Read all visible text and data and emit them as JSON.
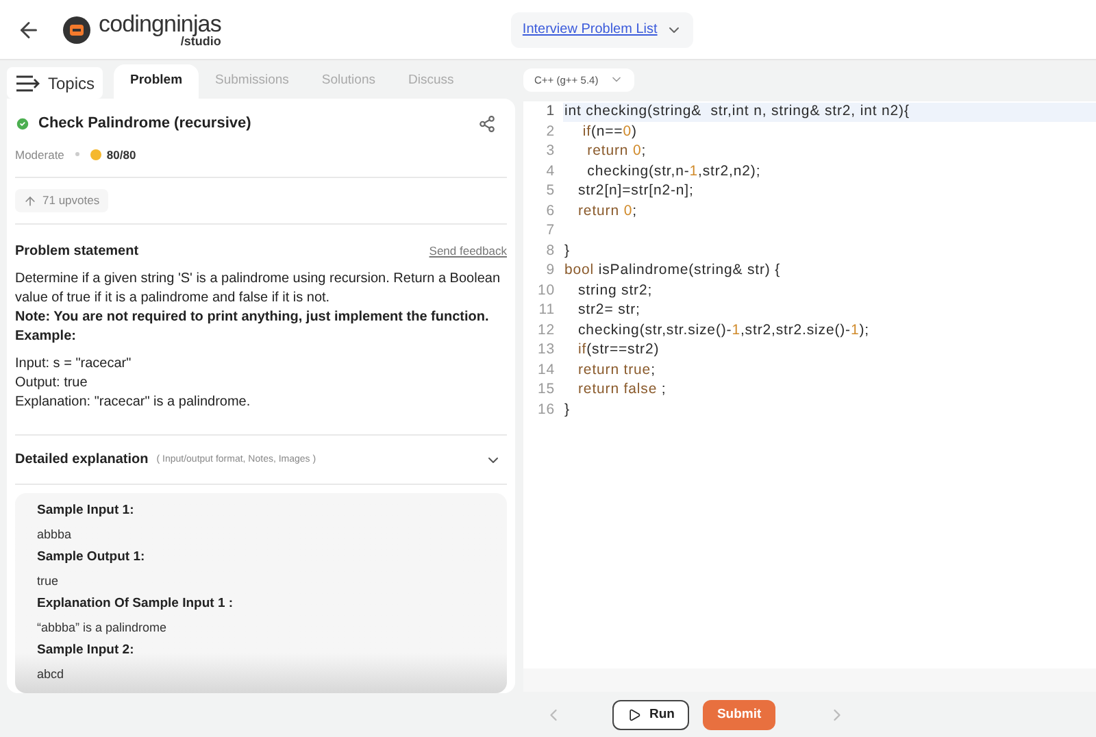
{
  "header": {
    "logo_name": "codingninjas",
    "logo_sub": "/studio",
    "problem_list": "Interview Problem List"
  },
  "tabs": [
    {
      "label": "Topics",
      "kind": "menu",
      "selected": false
    },
    {
      "label": "Problem",
      "kind": "tab",
      "selected": true
    },
    {
      "label": "Submissions",
      "kind": "tab",
      "selected": false
    },
    {
      "label": "Solutions",
      "kind": "tab",
      "selected": false
    },
    {
      "label": "Discuss",
      "kind": "tab",
      "selected": false
    }
  ],
  "problem": {
    "title": "Check Palindrome (recursive)",
    "solved": true,
    "difficulty": "Moderate",
    "score": "80/80",
    "upvotes": "71 upvotes",
    "statement_heading": "Problem statement",
    "feedback": "Send feedback",
    "statement": [
      "Determine if a given string 'S' is a palindrome using recursion. Return a Boolean value of true if it is a palindrome and false if it is not."
    ],
    "note": "Note: You are not required to print anything, just implement the function.",
    "example_heading": "Example:",
    "example": [
      "Input: s = \"racecar\"",
      "Output: true",
      "Explanation: \"racecar\" is a palindrome."
    ],
    "details_heading": "Detailed explanation",
    "details_hint": "( Input/output format, Notes, Images )",
    "samples": [
      {
        "kind": "heading",
        "text": "Sample Input 1:"
      },
      {
        "kind": "value",
        "text": "abbba"
      },
      {
        "kind": "heading",
        "text": "Sample Output 1:"
      },
      {
        "kind": "value",
        "text": "true"
      },
      {
        "kind": "heading",
        "text": "Explanation Of Sample Input 1 :"
      },
      {
        "kind": "value",
        "text": "“abbba” is a palindrome"
      },
      {
        "kind": "heading",
        "text": "Sample Input 2:"
      },
      {
        "kind": "value",
        "text": "abcd"
      }
    ]
  },
  "editor": {
    "language": "C++ (g++ 5.4)",
    "lines": [
      {
        "number": "1",
        "selected": true,
        "tokens": [
          {
            "kind": "plain",
            "text": "int checking(string&  str,int n, string& str2, int n2){"
          }
        ]
      },
      {
        "number": "2",
        "selected": false,
        "tokens": [
          {
            "kind": "keyword",
            "text": "    if"
          },
          {
            "kind": "plain",
            "text": "(n=="
          },
          {
            "kind": "number",
            "text": "0"
          },
          {
            "kind": "plain",
            "text": ")"
          }
        ]
      },
      {
        "number": "3",
        "selected": false,
        "tokens": [
          {
            "kind": "keyword",
            "text": "     return "
          },
          {
            "kind": "number",
            "text": "0"
          },
          {
            "kind": "plain",
            "text": ";"
          }
        ]
      },
      {
        "number": "4",
        "selected": false,
        "tokens": [
          {
            "kind": "plain",
            "text": "     checking(str,n-"
          },
          {
            "kind": "number",
            "text": "1"
          },
          {
            "kind": "plain",
            "text": ",str2,n2);"
          }
        ]
      },
      {
        "number": "5",
        "selected": false,
        "tokens": [
          {
            "kind": "plain",
            "text": "   str2[n]=str[n2-n];"
          }
        ]
      },
      {
        "number": "6",
        "selected": false,
        "tokens": [
          {
            "kind": "keyword",
            "text": "   return "
          },
          {
            "kind": "number",
            "text": "0"
          },
          {
            "kind": "plain",
            "text": ";"
          }
        ]
      },
      {
        "number": "7",
        "selected": false
      },
      {
        "number": "8",
        "selected": false,
        "tokens": [
          {
            "kind": "plain",
            "text": "}"
          }
        ]
      },
      {
        "number": "9",
        "selected": false,
        "tokens": [
          {
            "kind": "keyword",
            "text": "bool"
          },
          {
            "kind": "plain",
            "text": " isPalindrome(string& str) {"
          }
        ]
      },
      {
        "number": "10",
        "selected": false,
        "tokens": [
          {
            "kind": "plain",
            "text": "   string str2;"
          }
        ]
      },
      {
        "number": "11",
        "selected": false,
        "tokens": [
          {
            "kind": "plain",
            "text": "   str2= str;"
          }
        ]
      },
      {
        "number": "12",
        "selected": false,
        "tokens": [
          {
            "kind": "plain",
            "text": "   checking(str,str.size()-"
          },
          {
            "kind": "number",
            "text": "1"
          },
          {
            "kind": "plain",
            "text": ",str2,str2.size()-"
          },
          {
            "kind": "number",
            "text": "1"
          },
          {
            "kind": "plain",
            "text": ");"
          }
        ]
      },
      {
        "number": "13",
        "selected": false,
        "tokens": [
          {
            "kind": "keyword",
            "text": "   if"
          },
          {
            "kind": "plain",
            "text": "(str==str2)"
          }
        ]
      },
      {
        "number": "14",
        "selected": false,
        "tokens": [
          {
            "kind": "keyword",
            "text": "   return true"
          },
          {
            "kind": "plain",
            "text": ";"
          }
        ]
      },
      {
        "number": "15",
        "selected": false,
        "tokens": [
          {
            "kind": "keyword",
            "text": "   return false"
          },
          {
            "kind": "plain",
            "text": " ;"
          }
        ]
      },
      {
        "number": "16",
        "selected": false,
        "tokens": [
          {
            "kind": "plain",
            "text": "}"
          }
        ]
      }
    ]
  },
  "footer": {
    "run": "Run",
    "submit": "Submit"
  }
}
